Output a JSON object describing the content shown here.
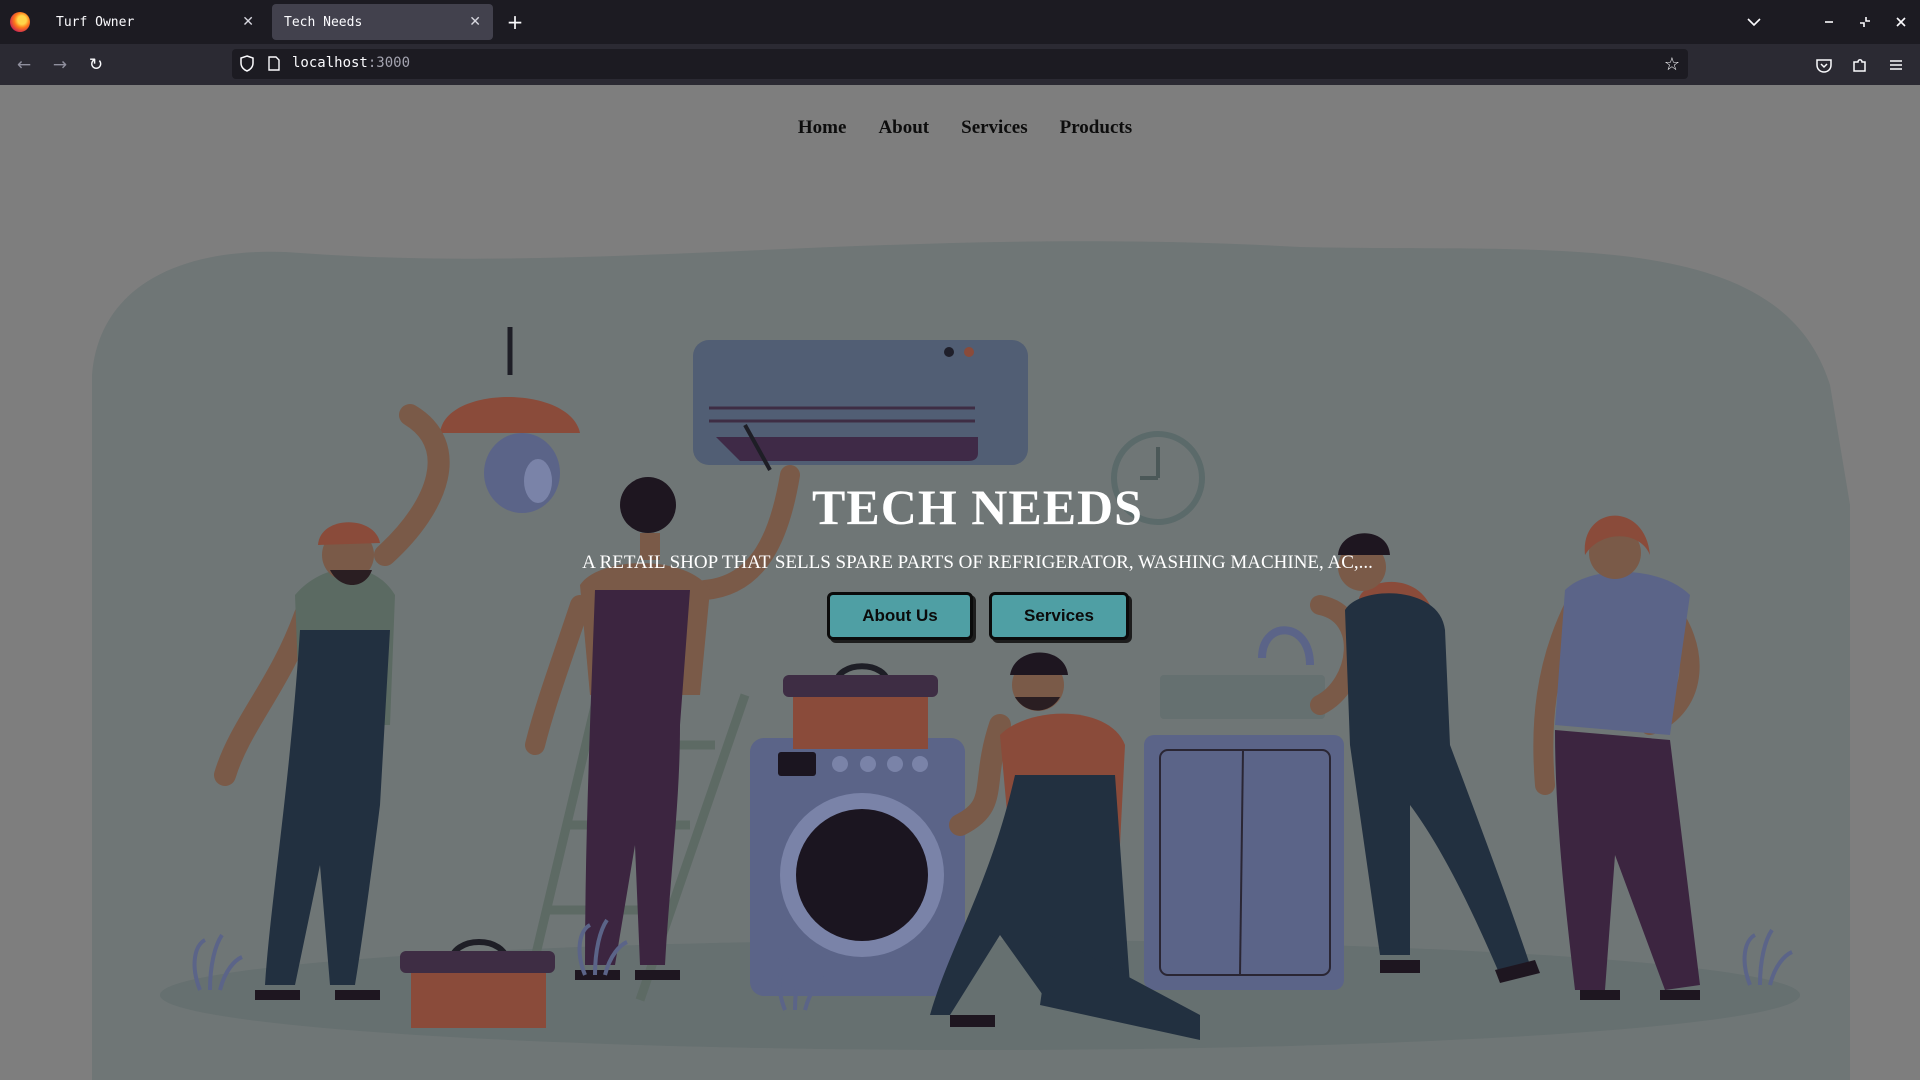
{
  "browser": {
    "tabs": [
      {
        "title": "Turf Owner",
        "active": false
      },
      {
        "title": "Tech Needs",
        "active": true
      }
    ],
    "url": {
      "host": "localhost",
      "port": ":3000"
    }
  },
  "nav": {
    "items": [
      "Home",
      "About",
      "Services",
      "Products"
    ]
  },
  "hero": {
    "title": "TECH NEEDS",
    "subtitle": "A RETAIL SHOP THAT SELLS SPARE PARTS OF REFRIGERATOR, WASHING MACHINE, AC,...",
    "buttons": {
      "about": "About Us",
      "services": "Services"
    },
    "button_color": "#4f9fa4"
  },
  "colors": {
    "page_bg": "#7e7e7e",
    "blob": "#6f7676",
    "chrome_dark": "#1c1b22",
    "chrome_toolbar": "#2b2a33"
  }
}
